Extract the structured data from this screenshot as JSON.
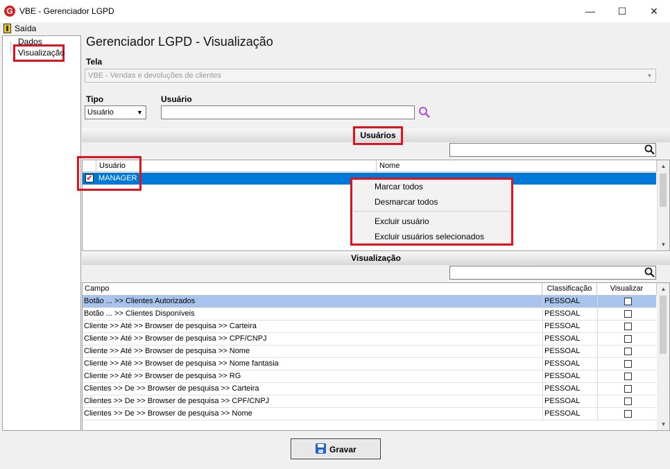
{
  "window": {
    "title": "VBE - Gerenciador LGPD",
    "minimize": "—",
    "maximize": "☐",
    "close": "✕"
  },
  "menu": {
    "exit_label": "Saída"
  },
  "tree": {
    "items": [
      "Dados",
      "Visualização"
    ]
  },
  "page": {
    "title": "Gerenciador LGPD - Visualização"
  },
  "form": {
    "tela_label": "Tela",
    "tela_value": "VBE - Vendas e devoluções de clientes",
    "tipo_label": "Tipo",
    "tipo_value": "Usuário",
    "usuario_label": "Usuário",
    "usuario_value": ""
  },
  "usuarios": {
    "title": "Usuários",
    "search_value": "",
    "columns": [
      "Usuário",
      "Nome"
    ],
    "rows": [
      {
        "checked": true,
        "usuario": "MANAGER",
        "nome": ""
      }
    ]
  },
  "context_menu": {
    "items": [
      "Marcar todos",
      "Desmarcar todos",
      "Excluir usuário",
      "Excluir usuários selecionados"
    ]
  },
  "visualizacao": {
    "title": "Visualização",
    "search_value": "",
    "columns": [
      "Campo",
      "Classificação",
      "Visualizar"
    ],
    "rows": [
      {
        "campo": "Botão ... >> Clientes Autorizados",
        "classificacao": "PESSOAL",
        "visualizar": false
      },
      {
        "campo": "Botão ... >> Clientes Disponíveis",
        "classificacao": "PESSOAL",
        "visualizar": false
      },
      {
        "campo": "Cliente >> Até >> Browser de pesquisa >> Carteira",
        "classificacao": "PESSOAL",
        "visualizar": false
      },
      {
        "campo": "Cliente >> Até >> Browser de pesquisa >> CPF/CNPJ",
        "classificacao": "PESSOAL",
        "visualizar": false
      },
      {
        "campo": "Cliente >> Até >> Browser de pesquisa >> Nome",
        "classificacao": "PESSOAL",
        "visualizar": false
      },
      {
        "campo": "Cliente >> Até >> Browser de pesquisa >> Nome fantasia",
        "classificacao": "PESSOAL",
        "visualizar": false
      },
      {
        "campo": "Cliente >> Até >> Browser de pesquisa >> RG",
        "classificacao": "PESSOAL",
        "visualizar": false
      },
      {
        "campo": "Clientes >> De >> Browser de pesquisa >> Carteira",
        "classificacao": "PESSOAL",
        "visualizar": false
      },
      {
        "campo": "Clientes >> De >> Browser de pesquisa >> CPF/CNPJ",
        "classificacao": "PESSOAL",
        "visualizar": false
      },
      {
        "campo": "Clientes >> De >> Browser de pesquisa >> Nome",
        "classificacao": "PESSOAL",
        "visualizar": false
      }
    ]
  },
  "footer": {
    "save_label": "Gravar"
  },
  "colors": {
    "selection": "#0078d7",
    "row_highlight": "#a8c4ec",
    "annotation": "#e3101e",
    "search_icon": "#b14fd6"
  }
}
